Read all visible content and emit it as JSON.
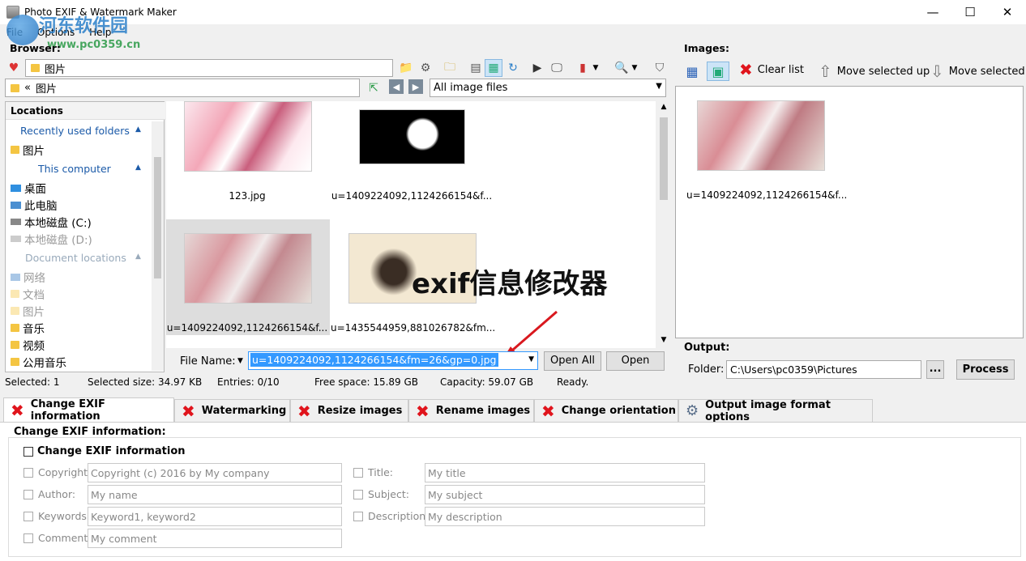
{
  "window": {
    "title": "Photo EXIF & Watermark Maker",
    "minimize": "—",
    "maximize": "☐",
    "close": "✕"
  },
  "menu": [
    "File",
    "Options",
    "Help"
  ],
  "watermark": {
    "site_name": "河东软件园",
    "site_url": "www.pc0359.cn"
  },
  "browser": {
    "label": "Browser:",
    "path_combo": "图片",
    "address": "图片",
    "address_prefix": "«",
    "filter": "All image files"
  },
  "locations": {
    "header": "Locations",
    "recent_label": "Recently used folders",
    "recent_items": [
      "图片"
    ],
    "computer_label": "This computer",
    "computer_items": [
      "桌面",
      "此电脑",
      "本地磁盘 (C:)",
      "本地磁盘 (D:)"
    ],
    "documents_label": "Document locations",
    "document_items": [
      "网络",
      "文档",
      "图片",
      "音乐",
      "视频",
      "公用音乐"
    ]
  },
  "thumbnails": [
    {
      "name": "123.jpg"
    },
    {
      "name": "u=1409224092,1124266154&f..."
    },
    {
      "name": "u=1409224092,1124266154&f..."
    },
    {
      "name": "u=1435544959,881026782&fm..."
    }
  ],
  "file_name": {
    "label": "File Name:",
    "value": "u=1409224092,1124266154&fm=26&gp=0.jpg",
    "open_all": "Open All",
    "open": "Open"
  },
  "status": {
    "selected": "Selected: 1",
    "selected_size": "Selected size: 34.97 KB",
    "entries": "Entries: 0/10",
    "free_space": "Free space: 15.89 GB",
    "capacity": "Capacity: 59.07 GB",
    "state": "Ready."
  },
  "images": {
    "label": "Images:",
    "clear": "Clear list",
    "move_up": "Move selected up",
    "move_down": "Move selected d",
    "items": [
      {
        "name": "u=1409224092,1124266154&f..."
      }
    ]
  },
  "output": {
    "label": "Output:",
    "folder_label": "Folder:",
    "folder": "C:\\Users\\pc0359\\Pictures",
    "browse": "...",
    "process": "Process"
  },
  "tabs": [
    "Change EXIF information",
    "Watermarking",
    "Resize images",
    "Rename images",
    "Change orientation",
    "Output image format options"
  ],
  "exif": {
    "section": "Change EXIF information:",
    "enable": "Change EXIF information",
    "copyright_label": "Copyright:",
    "copyright": "Copyright (c) 2016 by My company",
    "author_label": "Author:",
    "author": "My name",
    "keywords_label": "Keywords:",
    "keywords": "Keyword1, keyword2",
    "comment_label": "Comment:",
    "comment": "My comment",
    "title_label": "Title:",
    "title": "My title",
    "subject_label": "Subject:",
    "subject": "My subject",
    "description_label": "Description:",
    "description": "My description"
  },
  "overlay": {
    "caption": "exif信息修改器"
  },
  "colors": {
    "accent": "#0078d7",
    "red_x": "#e0141c",
    "selection": "#3399ff"
  }
}
